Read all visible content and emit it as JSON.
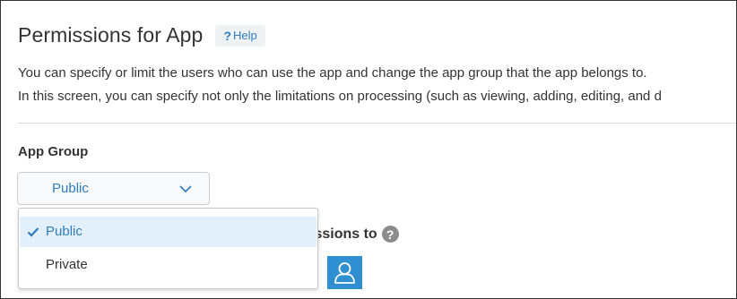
{
  "header": {
    "title": "Permissions for App",
    "help_label": "Help",
    "help_prefix": "?"
  },
  "description": {
    "line1": "You can specify or limit the users who can use the app and change the app group that the app belongs to.",
    "line2": "In this screen, you can specify not only the limitations on processing (such as viewing, adding, editing, and d"
  },
  "app_group": {
    "label": "App Group",
    "selected_value": "Public",
    "options": [
      {
        "label": "Public",
        "selected": true
      },
      {
        "label": "Private",
        "selected": false
      }
    ]
  },
  "permissions": {
    "label_partial": "issions to",
    "help_glyph": "?"
  },
  "colors": {
    "accent": "#2f7dbb",
    "user_button": "#2f8fd1",
    "selected_option_bg": "#e2f0fb"
  },
  "icons": [
    "chevron-down-icon",
    "check-icon",
    "help-circle-icon",
    "user-icon"
  ]
}
